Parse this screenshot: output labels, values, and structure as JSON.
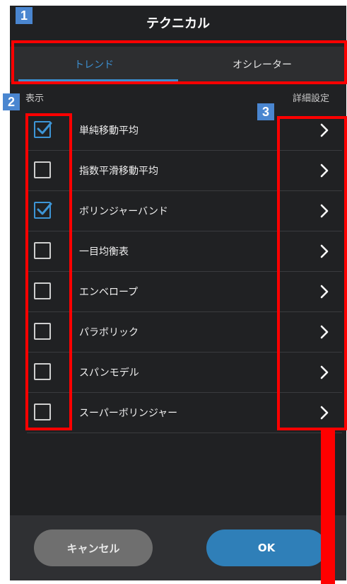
{
  "header": {
    "title": "テクニカル"
  },
  "tabs": [
    {
      "label": "トレンド",
      "active": true
    },
    {
      "label": "オシレーター",
      "active": false
    }
  ],
  "columns": {
    "display": "表示",
    "detail": "詳細設定"
  },
  "indicators": [
    {
      "label": "単純移動平均",
      "checked": true
    },
    {
      "label": "指数平滑移動平均",
      "checked": false
    },
    {
      "label": "ボリンジャーバンド",
      "checked": true
    },
    {
      "label": "一目均衡表",
      "checked": false
    },
    {
      "label": "エンベロープ",
      "checked": false
    },
    {
      "label": "パラボリック",
      "checked": false
    },
    {
      "label": "スパンモデル",
      "checked": false
    },
    {
      "label": "スーパーボリンジャー",
      "checked": false
    }
  ],
  "buttons": {
    "cancel": "キャンセル",
    "ok": "OK"
  },
  "annotations": {
    "marker1": "1",
    "marker2": "2",
    "marker3": "3"
  },
  "colors": {
    "accent": "#3d8fd0",
    "annotation": "#ff0000",
    "marker_bg": "#4a86d0"
  },
  "icons": {
    "check": "checkmark-icon",
    "chevron": "chevron-right-icon"
  }
}
